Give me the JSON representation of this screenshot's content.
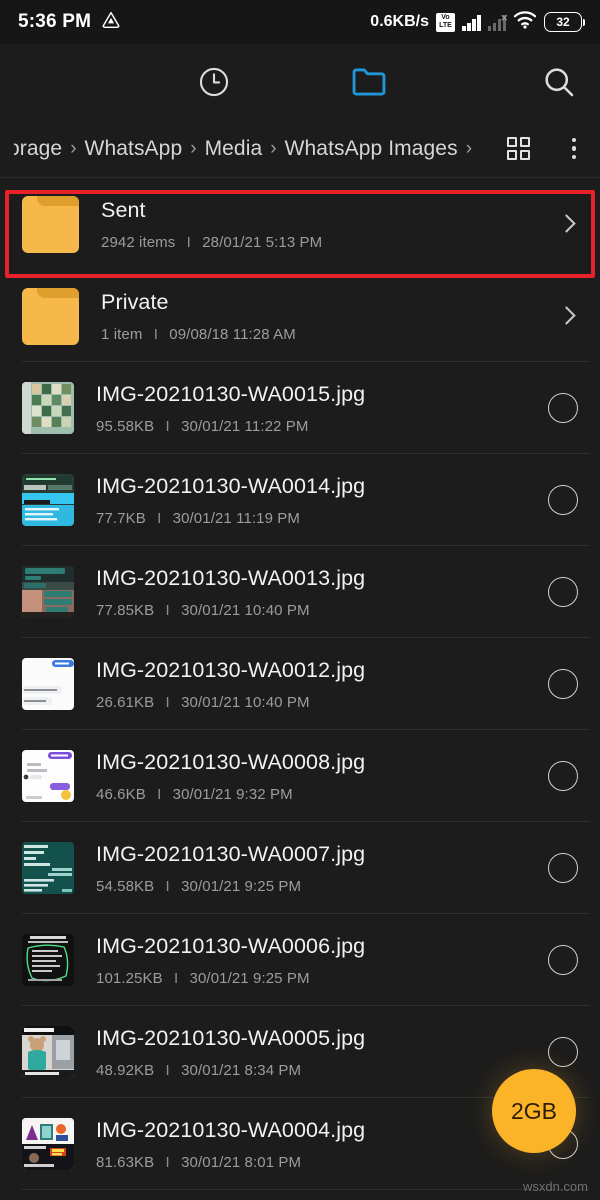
{
  "status_bar": {
    "time": "5:36 PM",
    "left_icon": "drive-triangle-icon",
    "network_speed": "0.6KB/s",
    "volte_label_top": "Vo",
    "volte_label_bottom": "LTE",
    "sim1_icon": "signal-bars-icon",
    "sim2_icon": "signal-bars-disabled-icon",
    "wifi_icon": "wifi-icon",
    "battery_level": "32"
  },
  "toolbar": {
    "menu_icon": "hamburger-menu-icon",
    "recent_icon": "clock-icon",
    "folder_icon": "folder-icon",
    "search_icon": "search-icon",
    "active_color": "#2196d6"
  },
  "breadcrumb": {
    "items": [
      {
        "label": "orage",
        "truncated": true
      },
      {
        "label": "WhatsApp",
        "truncated": false
      },
      {
        "label": "Media",
        "truncated": false
      },
      {
        "label": "WhatsApp Images",
        "truncated": false
      }
    ],
    "separator": "›",
    "grid_view_icon": "grid-view-icon",
    "overflow_icon": "more-vertical-icon"
  },
  "highlight": {
    "color": "#e8212a",
    "target": "sent-folder-row"
  },
  "folders": [
    {
      "name": "Sent",
      "count": "2942 items",
      "date": "28/01/21 5:13 PM",
      "icon": "folder-icon",
      "chevron": "chevron-right-icon",
      "highlighted": true
    },
    {
      "name": "Private",
      "count": "1 item",
      "date": "09/08/18 11:28 AM",
      "icon": "folder-icon",
      "chevron": "chevron-right-icon",
      "highlighted": false
    }
  ],
  "files": [
    {
      "name": "IMG-20210130-WA0015.jpg",
      "size": "95.58KB",
      "date": "30/01/21 11:22 PM",
      "thumb": "collage-grid-thumbnail",
      "selected": false
    },
    {
      "name": "IMG-20210130-WA0014.jpg",
      "size": "77.7KB",
      "date": "30/01/21 11:19 PM",
      "thumb": "screenshot-cyan-thumbnail",
      "selected": false
    },
    {
      "name": "IMG-20210130-WA0013.jpg",
      "size": "77.85KB",
      "date": "30/01/21 10:40 PM",
      "thumb": "chat-teal-thumbnail",
      "selected": false
    },
    {
      "name": "IMG-20210130-WA0012.jpg",
      "size": "26.61KB",
      "date": "30/01/21 10:40 PM",
      "thumb": "chat-white-thumbnail",
      "selected": false
    },
    {
      "name": "IMG-20210130-WA0008.jpg",
      "size": "46.6KB",
      "date": "30/01/21 9:32 PM",
      "thumb": "chat-light-thumbnail",
      "selected": false
    },
    {
      "name": "IMG-20210130-WA0007.jpg",
      "size": "54.58KB",
      "date": "30/01/21 9:25 PM",
      "thumb": "chat-darkteal-thumbnail",
      "selected": false
    },
    {
      "name": "IMG-20210130-WA0006.jpg",
      "size": "101.25KB",
      "date": "30/01/21 9:25 PM",
      "thumb": "note-dark-thumbnail",
      "selected": false
    },
    {
      "name": "IMG-20210130-WA0005.jpg",
      "size": "48.92KB",
      "date": "30/01/21 8:34 PM",
      "thumb": "teddy-photo-thumbnail",
      "selected": false
    },
    {
      "name": "IMG-20210130-WA0004.jpg",
      "size": "81.63KB",
      "date": "30/01/21 8:01 PM",
      "thumb": "poster-photo-thumbnail",
      "selected": false
    }
  ],
  "meta_separator": "I",
  "fab": {
    "label": "2GB",
    "color": "#fbb327"
  },
  "watermark": "wsxdn.com"
}
